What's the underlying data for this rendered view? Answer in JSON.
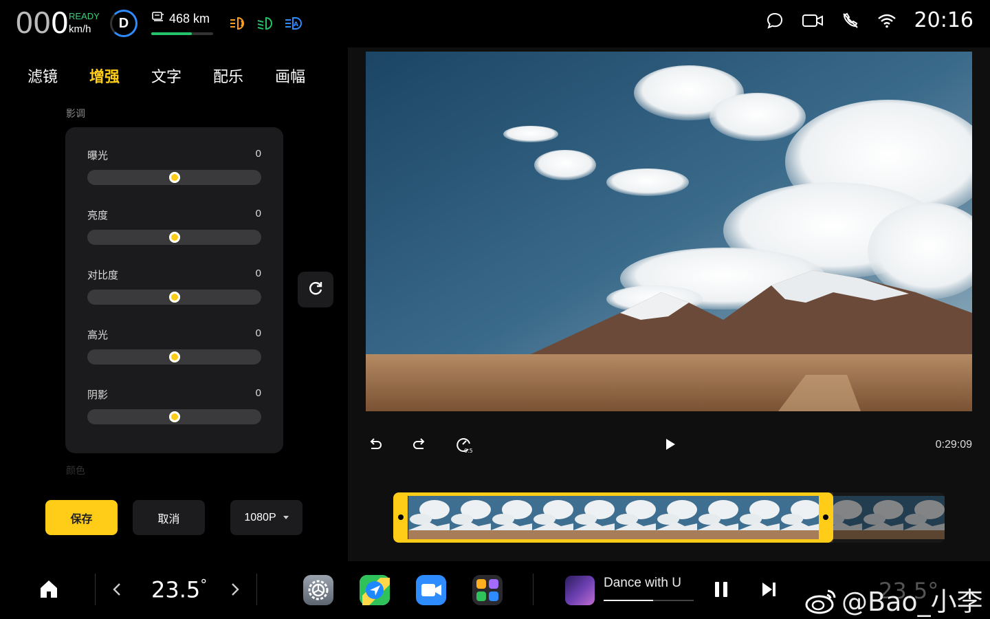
{
  "status": {
    "speed_dim": "00",
    "speed_main": "0",
    "ready": "READY",
    "unit": "km/h",
    "gear": "D",
    "range": "468 km",
    "range_level": 0.65,
    "clock": "20:16"
  },
  "editor": {
    "tabs": [
      {
        "label": "滤镜",
        "active": false
      },
      {
        "label": "增强",
        "active": true
      },
      {
        "label": "文字",
        "active": false
      },
      {
        "label": "配乐",
        "active": false
      },
      {
        "label": "画幅",
        "active": false
      }
    ],
    "section_title": "影调",
    "next_section_title": "颜色",
    "adjustments": [
      {
        "label": "曝光",
        "value": "0",
        "level": 0.5
      },
      {
        "label": "亮度",
        "value": "0",
        "level": 0.5
      },
      {
        "label": "对比度",
        "value": "0",
        "level": 0.5
      },
      {
        "label": "高光",
        "value": "0",
        "level": 0.5
      },
      {
        "label": "阴影",
        "value": "0",
        "level": 0.5
      }
    ],
    "save_label": "保存",
    "cancel_label": "取消",
    "resolution": "1080P"
  },
  "player": {
    "time": "0:29:09",
    "speed_badge": "0.5"
  },
  "dock": {
    "temp_left": "23.5",
    "degree": "°",
    "song_title": "Dance with U",
    "song_progress": 0.55,
    "watermark": "@Bao_小李",
    "temp_right": "23.5°",
    "apps": [
      "settings-app",
      "navigation-app",
      "video-call-app",
      "app-folder"
    ]
  },
  "colors": {
    "accent": "#ffcc17",
    "ready_green": "#3ccf7a",
    "range_green": "#25c46a",
    "gear_blue": "#2f8cff",
    "lamp_orange": "#ff9f1a",
    "lamp_green": "#25c46a",
    "lamp_blue": "#2f8cff"
  }
}
